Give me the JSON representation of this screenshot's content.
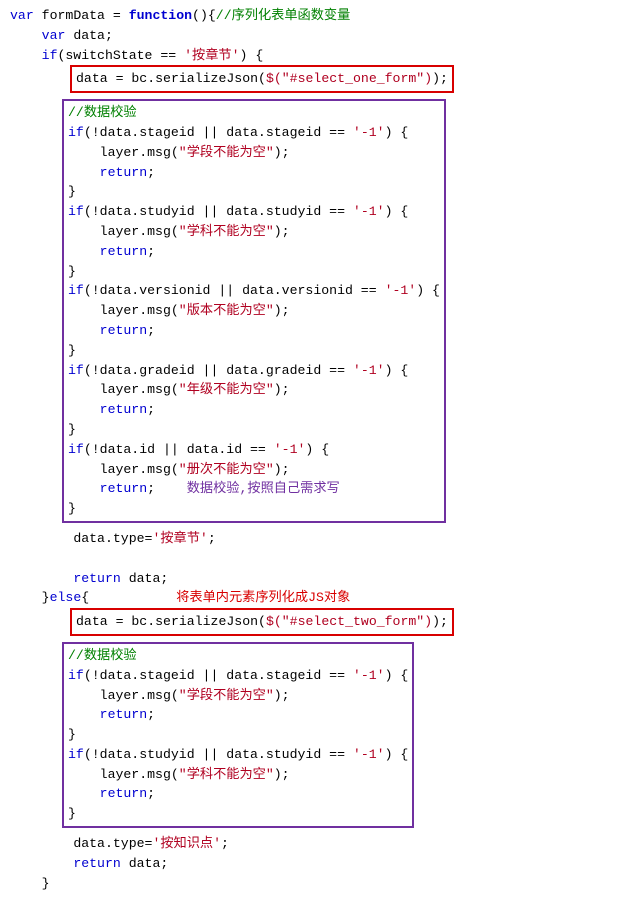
{
  "code": {
    "l01_a": "var",
    "l01_b": " formData = ",
    "l01_c": "function",
    "l01_d": "(){",
    "l01_cmt": "//序列化表单函数变量",
    "l02_a": "var",
    "l02_b": " data;",
    "l03_a": "if",
    "l03_b": "(switchState == ",
    "l03_str": "'按章节'",
    "l03_c": ") {",
    "box1": "data = bc.serializeJson($(\"#select_one_form\"));",
    "box1_pre": "data = bc.serializeJson(",
    "box1_jq": "$(",
    "box1_str": "\"#select_one_form\"",
    "box1_jq2": ")",
    "box1_post": ");",
    "box2_cmt": "//数据校验",
    "b2_l1_a": "if",
    "b2_l1_b": "(!data.stageid || data.stageid == ",
    "b2_l1_str": "'-1'",
    "b2_l1_c": ") {",
    "b2_l2_a": "layer.msg(",
    "b2_l2_str": "\"学段不能为空\"",
    "b2_l2_b": ");",
    "b2_l3": "return",
    "b2_l3b": ";",
    "b2_l4": "}",
    "b2_l5_a": "if",
    "b2_l5_b": "(!data.studyid || data.studyid == ",
    "b2_l5_str": "'-1'",
    "b2_l5_c": ") {",
    "b2_l6_a": "layer.msg(",
    "b2_l6_str": "\"学科不能为空\"",
    "b2_l6_b": ");",
    "b2_l7": "return",
    "b2_l7b": ";",
    "b2_l8": "}",
    "b2_l9_a": "if",
    "b2_l9_b": "(!data.versionid || data.versionid == ",
    "b2_l9_str": "'-1'",
    "b2_l9_c": ") {",
    "b2_l10_a": "layer.msg(",
    "b2_l10_str": "\"版本不能为空\"",
    "b2_l10_b": ");",
    "b2_l11": "return",
    "b2_l11b": ";",
    "b2_l12": "}",
    "b2_l13_a": "if",
    "b2_l13_b": "(!data.gradeid || data.gradeid == ",
    "b2_l13_str": "'-1'",
    "b2_l13_c": ") {",
    "b2_l14_a": "layer.msg(",
    "b2_l14_str": "\"年级不能为空\"",
    "b2_l14_b": ");",
    "b2_l15": "return",
    "b2_l15b": ";",
    "b2_l16": "}",
    "b2_l17_a": "if",
    "b2_l17_b": "(!data.id || data.id == ",
    "b2_l17_str": "'-1'",
    "b2_l17_c": ") {",
    "b2_l18_a": "layer.msg(",
    "b2_l18_str": "\"册次不能为空\"",
    "b2_l18_b": ");",
    "b2_l19": "return",
    "b2_l19b": ";",
    "b2_annot": "数据校验,按照自己需求写",
    "b2_l20": "}",
    "mid1_a": "data.type=",
    "mid1_str": "'按章节'",
    "mid1_b": ";",
    "mid2_a": "return",
    "mid2_b": " data;",
    "else_a": "}",
    "else_b": "else",
    "else_c": "{",
    "annot_serialize": "将表单内元素序列化成JS对象",
    "box3_pre": "data = bc.serializeJson(",
    "box3_jq": "$(",
    "box3_str": "\"#select_two_form\"",
    "box3_jq2": ")",
    "box3_post": ");",
    "box4_cmt": "//数据校验",
    "b4_l1_a": "if",
    "b4_l1_b": "(!data.stageid || data.stageid == ",
    "b4_l1_str": "'-1'",
    "b4_l1_c": ") {",
    "b4_l2_a": "layer.msg(",
    "b4_l2_str": "\"学段不能为空\"",
    "b4_l2_b": ");",
    "b4_l3": "return",
    "b4_l3b": ";",
    "b4_l4": "}",
    "b4_l5_a": "if",
    "b4_l5_b": "(!data.studyid || data.studyid == ",
    "b4_l5_str": "'-1'",
    "b4_l5_c": ") {",
    "b4_l6_a": "layer.msg(",
    "b4_l6_str": "\"学科不能为空\"",
    "b4_l6_b": ");",
    "b4_l7": "return",
    "b4_l7b": ";",
    "b4_l8": "}",
    "end1_a": "data.type=",
    "end1_str": "'按知识点'",
    "end1_b": ";",
    "end2_a": "return",
    "end2_b": " data;",
    "end3": "}"
  }
}
